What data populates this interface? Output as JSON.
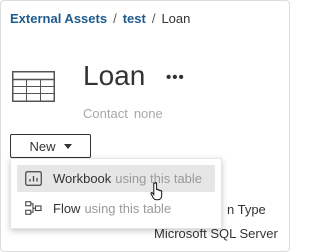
{
  "breadcrumb": {
    "items": [
      {
        "label": "External Assets"
      },
      {
        "label": "test"
      },
      {
        "label": "Loan"
      }
    ],
    "separator": "/"
  },
  "asset": {
    "icon": "table-icon",
    "title": "Loan",
    "more_label": "•••",
    "contact_label": "Contact",
    "contact_value": "none"
  },
  "new_button": {
    "label": "New",
    "icon": "caret-down-icon"
  },
  "new_menu": {
    "items": [
      {
        "icon": "workbook-icon",
        "label": "Workbook",
        "suffix": "using this table",
        "state": "hover"
      },
      {
        "icon": "flow-icon",
        "label": "Flow",
        "suffix": "using this table",
        "state": "normal"
      }
    ]
  },
  "background_details": {
    "type_label_partial": "n Type",
    "type_value": "Microsoft SQL Server"
  },
  "colors": {
    "link": "#1f5b8e",
    "text": "#333333",
    "muted": "#a8a8a8",
    "menu_hover": "#e6e6e6"
  }
}
